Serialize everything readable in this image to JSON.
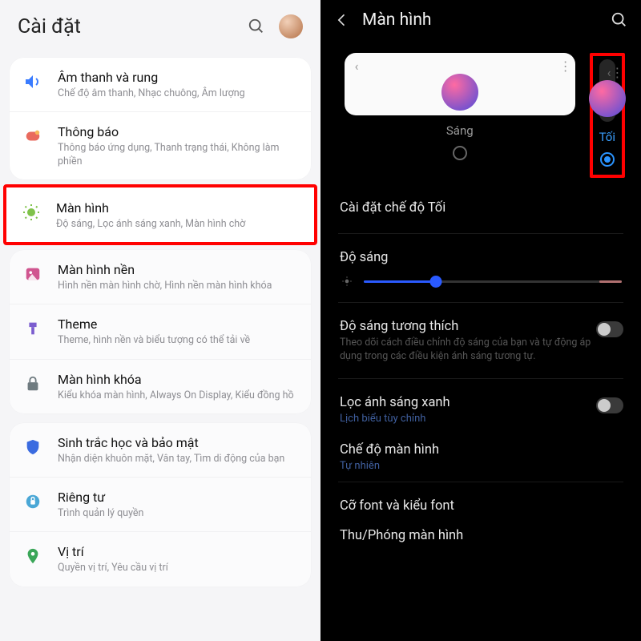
{
  "left": {
    "header_title": "Cài đặt",
    "items": [
      {
        "icon": "sound",
        "title": "Âm thanh và rung",
        "sub": "Chế độ âm thanh, Nhạc chuông, Âm lượng",
        "color": "#3a7cff"
      },
      {
        "icon": "notif",
        "title": "Thông báo",
        "sub": "Thông báo ứng dụng, Thanh trạng thái, Không làm phiền",
        "color": "#e96a5e"
      },
      {
        "icon": "display",
        "title": "Màn hình",
        "sub": "Độ sáng, Lọc ánh sáng xanh, Màn hình chờ",
        "color": "#7fc24a",
        "highlight": true
      },
      {
        "icon": "wallpaper",
        "title": "Màn hình nền",
        "sub": "Hình nền màn hình chờ, Hình nền màn hình khóa",
        "color": "#d0558f"
      },
      {
        "icon": "theme",
        "title": "Theme",
        "sub": "Theme, hình nền và biểu tượng có thể tải về",
        "color": "#7b5dcf"
      },
      {
        "icon": "lock",
        "title": "Màn hình khóa",
        "sub": "Kiểu khóa màn hình, Always On Display, Kiểu đồng hồ",
        "color": "#6f7b80"
      },
      {
        "icon": "biometrics",
        "title": "Sinh trắc học và bảo mật",
        "sub": "Nhận diện khuôn mặt, Vân tay, Tìm di động của bạn",
        "color": "#3a6be0"
      },
      {
        "icon": "privacy",
        "title": "Riêng tư",
        "sub": "Trình quản lý quyền",
        "color": "#4aa7d6"
      },
      {
        "icon": "location",
        "title": "Vị trí",
        "sub": "Quyền vị trí, Yêu cầu vị trí",
        "color": "#3aa658"
      }
    ]
  },
  "right": {
    "title": "Màn hình",
    "modes": {
      "light": "Sáng",
      "dark": "Tối"
    },
    "dark_mode_settings": "Cài đặt chế độ Tối",
    "brightness_label": "Độ sáng",
    "brightness_value": 0.28,
    "adaptive_brightness": {
      "title": "Độ sáng tương thích",
      "sub": "Theo dõi cách điều chỉnh độ sáng của bạn và tự động áp dụng trong các điều kiện ánh sáng tương tự."
    },
    "blue_light": {
      "title": "Lọc ánh sáng xanh",
      "link": "Lịch biểu tùy chỉnh"
    },
    "screen_mode": {
      "title": "Chế độ màn hình",
      "value": "Tự nhiên"
    },
    "font": "Cỡ font và kiểu font",
    "zoom": "Thu/Phóng màn hình"
  }
}
